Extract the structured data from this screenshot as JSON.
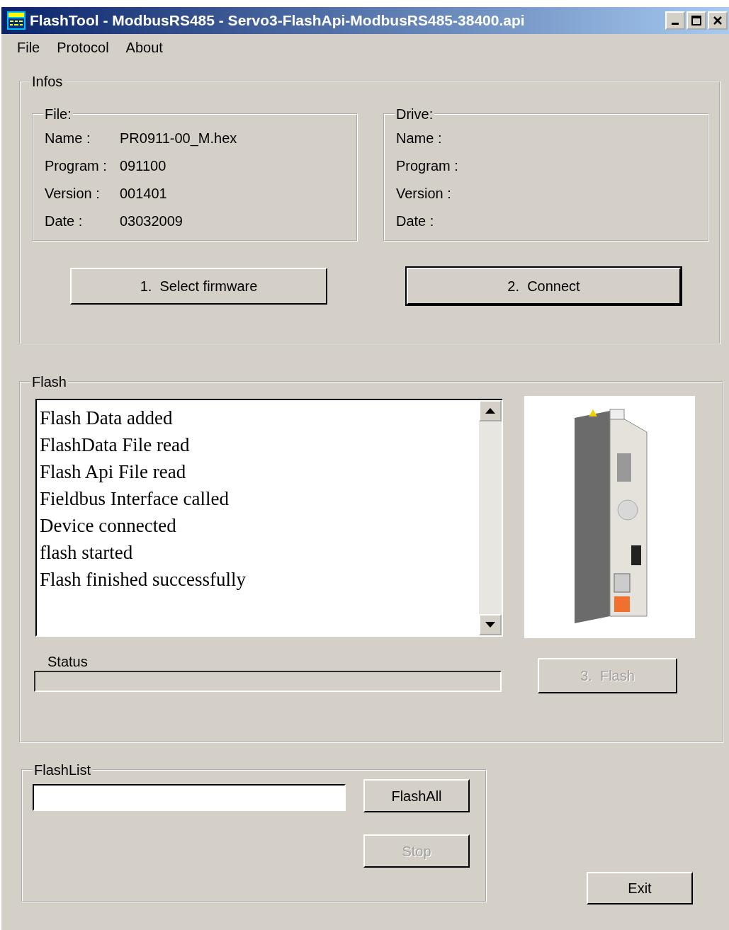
{
  "window": {
    "title": "FlashTool - ModbusRS485 - Servo3-FlashApi-ModbusRS485-38400.api"
  },
  "menu": [
    {
      "label": "File"
    },
    {
      "label": "Protocol"
    },
    {
      "label": "About"
    }
  ],
  "infos": {
    "title": "Infos",
    "groups": [
      {
        "title": "File:",
        "fields": [
          {
            "label": "Name :",
            "value": "PR0911-00_M.hex"
          },
          {
            "label": "Program :",
            "value": "091100"
          },
          {
            "label": "Version :",
            "value": "001401"
          },
          {
            "label": "Date :",
            "value": "03032009"
          }
        ]
      },
      {
        "title": "Drive:",
        "fields": [
          {
            "label": "Name :"
          },
          {
            "label": "Program :"
          },
          {
            "label": "Version :"
          },
          {
            "label": "Date :"
          }
        ]
      }
    ],
    "buttons": [
      {
        "label": "1.  Select firmware",
        "default": false
      },
      {
        "label": "2.  Connect",
        "default": true
      }
    ]
  },
  "flash": {
    "title": "Flash",
    "log": [
      "Flash Data added",
      "FlashData File read",
      "Flash Api File read",
      "Fieldbus Interface called",
      "Device connected",
      "flash started",
      "Flash finished successfully"
    ],
    "status_label": "Status",
    "progress": {
      "level": 0
    },
    "flash_button": {
      "label": "3.  Flash",
      "disabled": true
    }
  },
  "flashlist": {
    "title": "FlashList",
    "buttons": [
      {
        "label": "FlashAll",
        "disabled": false
      },
      {
        "label": "Stop",
        "disabled": true
      }
    ]
  },
  "exit_button": {
    "label": "Exit"
  }
}
